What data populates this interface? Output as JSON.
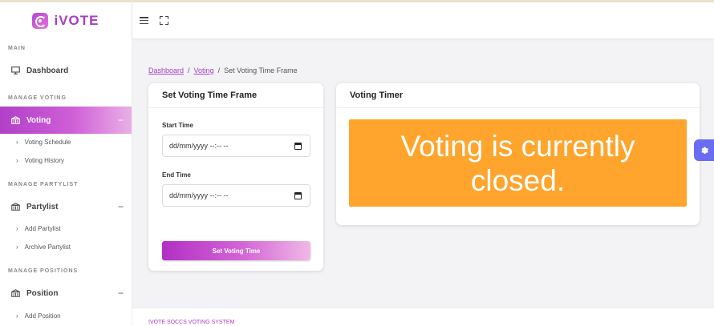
{
  "brand": {
    "name": "iVOTE",
    "logo_icon": "fingerprint-icon"
  },
  "sidebar": {
    "sections": {
      "main": "MAIN",
      "manage_voting": "MANAGE VOTING",
      "manage_partylist": "MANAGE PARTYLIST",
      "manage_positions": "MANAGE POSITIONS"
    },
    "dashboard": {
      "label": "Dashboard",
      "icon": "monitor-icon"
    },
    "voting": {
      "label": "Voting",
      "icon": "ballot-box-icon",
      "toggle": "−"
    },
    "voting_items": [
      "Voting Schedule",
      "Voting History"
    ],
    "partylist": {
      "label": "Partylist",
      "icon": "building-icon",
      "toggle": "−"
    },
    "partylist_items": [
      "Add Partylist",
      "Archive Partylist"
    ],
    "position": {
      "label": "Position",
      "icon": "building-icon",
      "toggle": "−"
    },
    "position_items": [
      "Add Position"
    ]
  },
  "header": {
    "menu_icon": "hamburger-icon",
    "fullscreen_icon": "fullscreen-icon"
  },
  "breadcrumb": {
    "items": [
      "Dashboard",
      "Voting"
    ],
    "separator": "/",
    "current": "Set Voting Time Frame"
  },
  "time_frame_card": {
    "title": "Set Voting Time Frame",
    "start_label": "Start Time",
    "start_value": "dd/mm/yyyy --:-- --",
    "end_label": "End Time",
    "end_value": "dd/mm/yyyy --:-- --",
    "button_label": "Set Voting Time"
  },
  "timer_card": {
    "title": "Voting Timer",
    "status_text": "Voting is currently closed.",
    "status_color": "#ffa42c"
  },
  "footer": {
    "text": "IVOTE SOCCS VOTING SYSTEM"
  },
  "colors": {
    "accent": "#a63fc2",
    "fab": "#6a6df1"
  }
}
